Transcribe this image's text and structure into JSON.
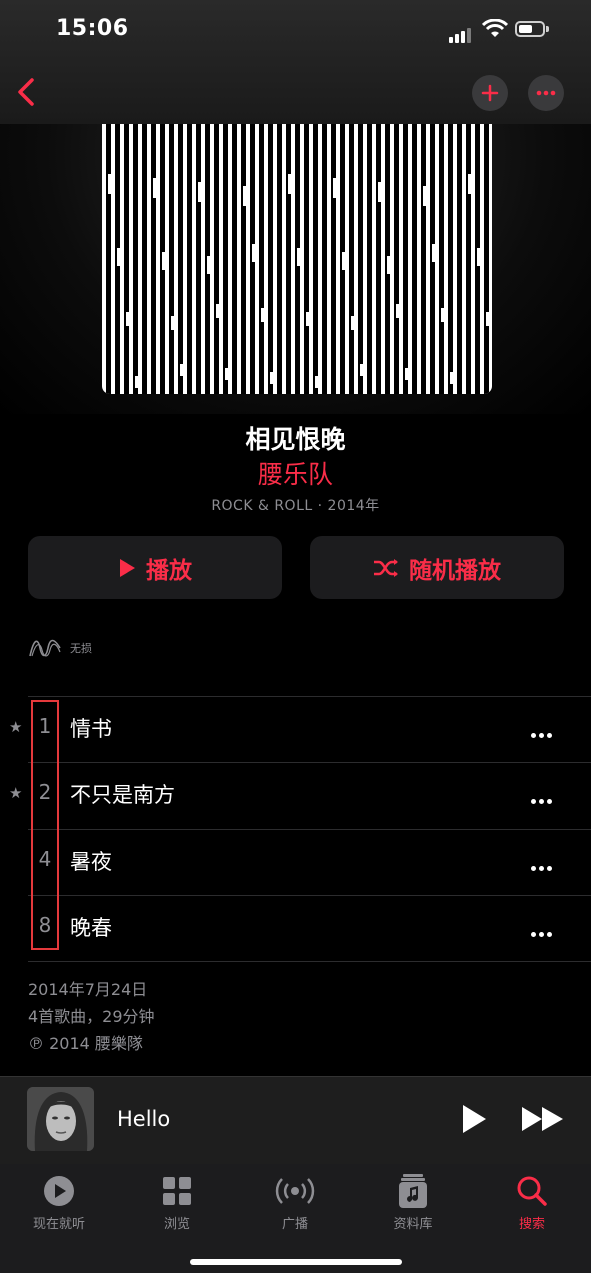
{
  "status_bar": {
    "time": "15:06"
  },
  "album": {
    "title": "相见恨晚",
    "artist": "腰乐队",
    "meta": "ROCK & ROLL · 2014年"
  },
  "actions": {
    "play_label": "播放",
    "shuffle_label": "随机播放"
  },
  "lossless_label": "无损",
  "tracks": [
    {
      "number": "1",
      "name": "情书",
      "starred": true
    },
    {
      "number": "2",
      "name": "不只是南方",
      "starred": true
    },
    {
      "number": "4",
      "name": "暑夜",
      "starred": false
    },
    {
      "number": "8",
      "name": "晚春",
      "starred": false
    }
  ],
  "info": {
    "release_date": "2014年7月24日",
    "summary": "4首歌曲，29分钟",
    "copyright": "℗ 2014 腰樂隊"
  },
  "mini_player": {
    "title": "Hello"
  },
  "tab_bar": [
    {
      "label": "现在就听",
      "icon": "play-circle-icon"
    },
    {
      "label": "浏览",
      "icon": "grid-icon"
    },
    {
      "label": "广播",
      "icon": "radio-waves-icon"
    },
    {
      "label": "资料库",
      "icon": "music-library-icon"
    },
    {
      "label": "搜索",
      "icon": "search-icon",
      "active": true
    }
  ],
  "colors": {
    "accent": "#fa2d48",
    "highlight_box": "#e5393c",
    "secondary_text": "#8e8e93"
  }
}
